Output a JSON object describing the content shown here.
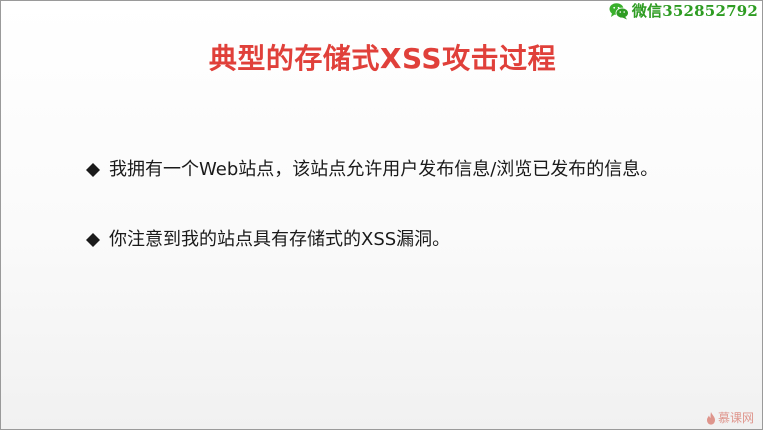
{
  "watermark_top": {
    "icon": "wechat-icon",
    "text": "微信352852792",
    "color": "#2e9c22"
  },
  "slide": {
    "title": "典型的存储式XSS攻击过程",
    "title_color": "#e0403a",
    "bullet_icon": "diamond-bullet-icon",
    "bullets": [
      {
        "text": "我拥有一个Web站点，该站点允许用户发布信息/浏览已发布的信息。"
      },
      {
        "text": "你注意到我的站点具有存储式的XSS漏洞。"
      }
    ]
  },
  "watermark_bottom": {
    "icon": "flame-icon",
    "text": "慕课网"
  }
}
